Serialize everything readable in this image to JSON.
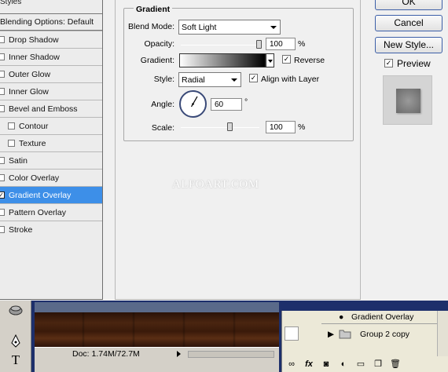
{
  "styles_list": {
    "header_partial": "Styles",
    "blending_options": "Blending Options: Default",
    "items": [
      {
        "label": "Drop Shadow",
        "checked": false,
        "sub": false,
        "selected": false
      },
      {
        "label": "Inner Shadow",
        "checked": false,
        "sub": false,
        "selected": false
      },
      {
        "label": "Outer Glow",
        "checked": false,
        "sub": false,
        "selected": false
      },
      {
        "label": "Inner Glow",
        "checked": false,
        "sub": false,
        "selected": false
      },
      {
        "label": "Bevel and Emboss",
        "checked": false,
        "sub": false,
        "selected": false
      },
      {
        "label": "Contour",
        "checked": false,
        "sub": true,
        "selected": false
      },
      {
        "label": "Texture",
        "checked": false,
        "sub": true,
        "selected": false
      },
      {
        "label": "Satin",
        "checked": false,
        "sub": false,
        "selected": false
      },
      {
        "label": "Color Overlay",
        "checked": false,
        "sub": false,
        "selected": false
      },
      {
        "label": "Gradient Overlay",
        "checked": true,
        "sub": false,
        "selected": true
      },
      {
        "label": "Pattern Overlay",
        "checked": false,
        "sub": false,
        "selected": false
      },
      {
        "label": "Stroke",
        "checked": false,
        "sub": false,
        "selected": false
      }
    ]
  },
  "gradient_panel": {
    "group_title": "Gradient",
    "blend_mode_label": "Blend Mode:",
    "blend_mode_value": "Soft Light",
    "opacity_label": "Opacity:",
    "opacity_value": "100",
    "opacity_fraction": 1.0,
    "percent": "%",
    "gradient_label": "Gradient:",
    "reverse_label": "Reverse",
    "reverse_checked": true,
    "style_label": "Style:",
    "style_value": "Radial",
    "align_label": "Align with Layer",
    "align_checked": true,
    "angle_label": "Angle:",
    "angle_value": "60",
    "degree": "°",
    "scale_label": "Scale:",
    "scale_value": "100",
    "scale_fraction": 0.63
  },
  "buttons": {
    "ok": "OK",
    "cancel": "Cancel",
    "new_style": "New Style...",
    "preview_label": "Preview",
    "preview_checked": true
  },
  "watermark": "ALFOART.COM",
  "document": {
    "status_text": "Doc: 1.74M/72.7M"
  },
  "layers_panel": {
    "effect_label": "Gradient Overlay",
    "group_label": "Group 2 copy",
    "footer_icons": [
      "link-icon",
      "fx-icon",
      "mask-icon",
      "adjustment-icon",
      "folder-icon",
      "new-layer-icon",
      "trash-icon"
    ]
  },
  "check_mark": "✓"
}
